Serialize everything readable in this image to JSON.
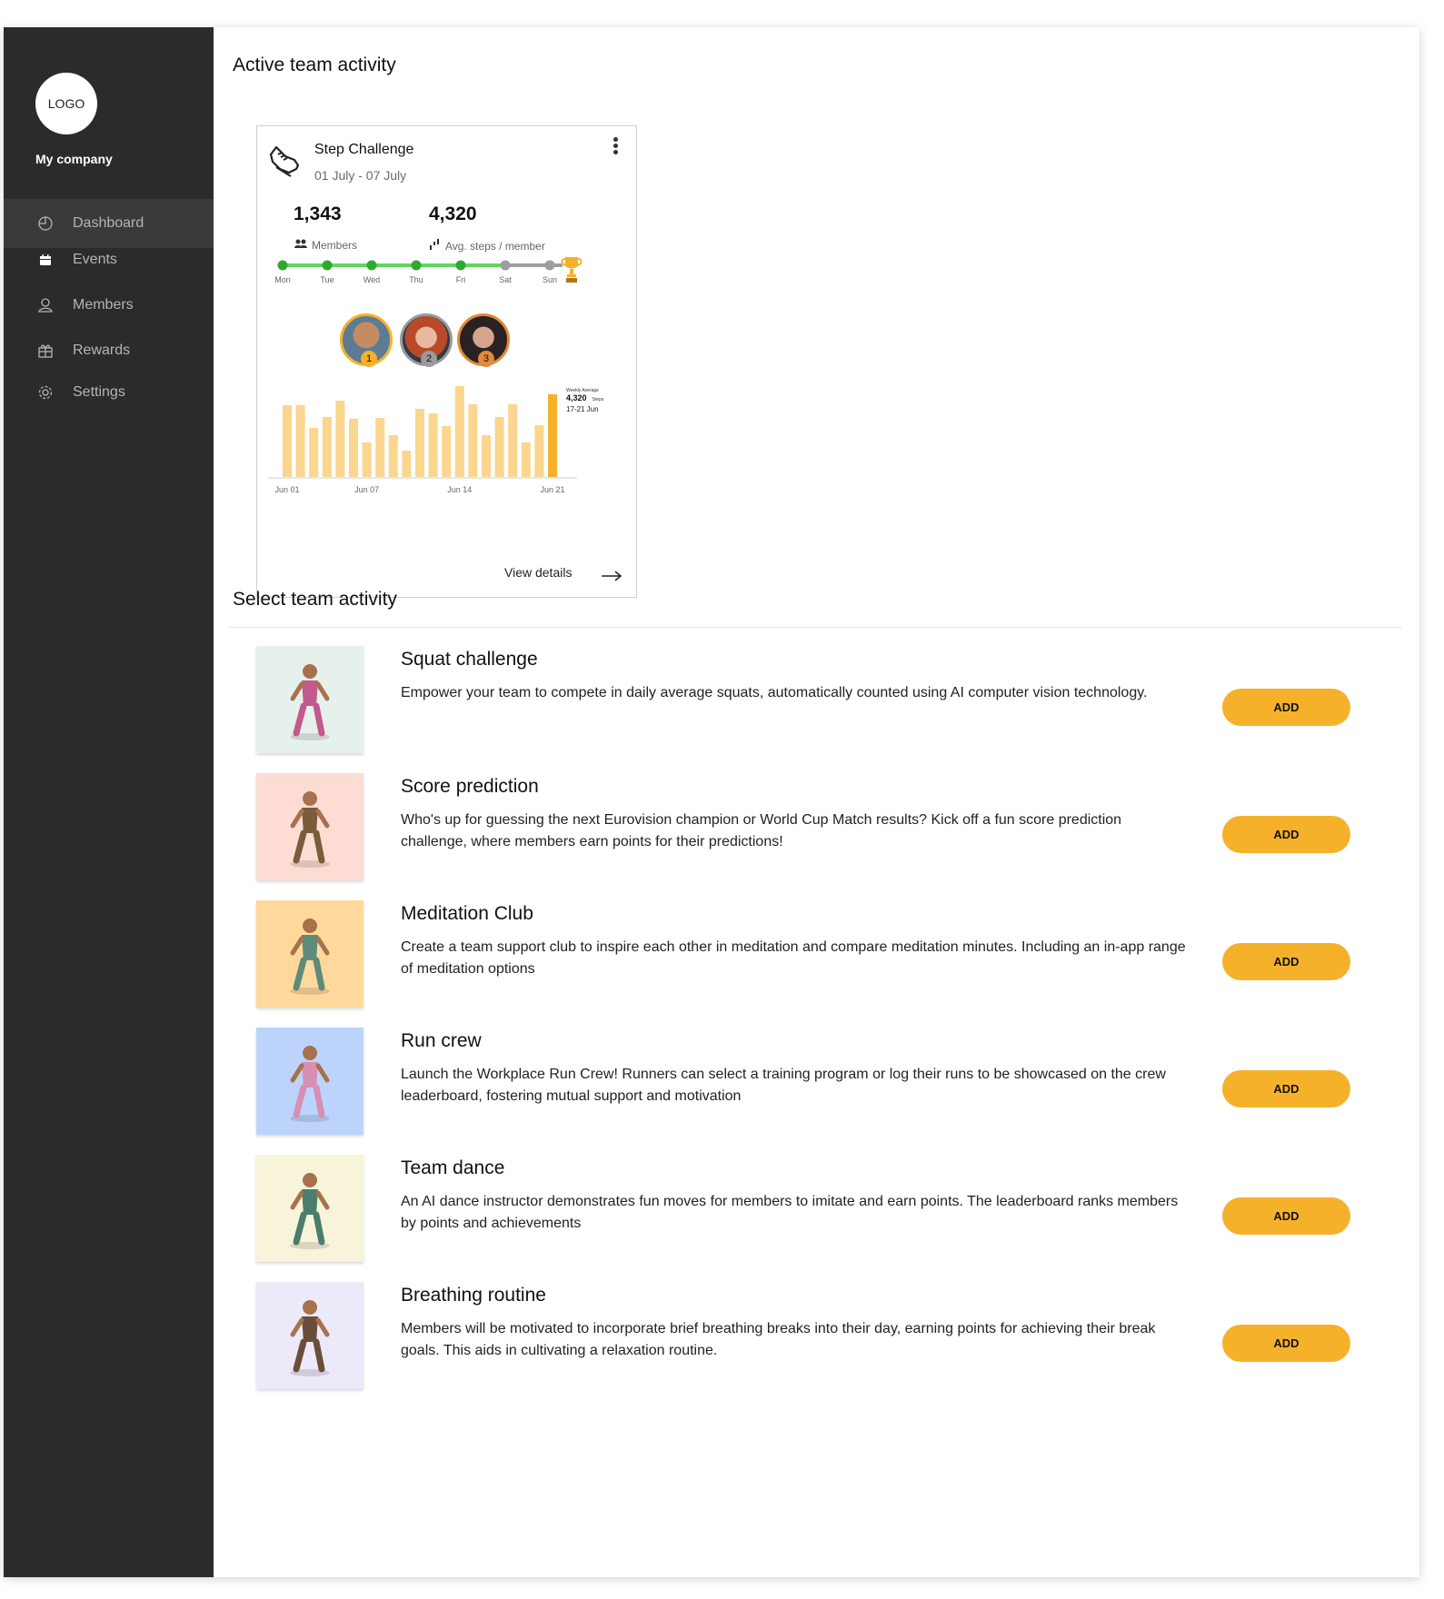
{
  "sidebar": {
    "logo": "LOGO",
    "company": "My company",
    "items": [
      {
        "label": "Dashboard",
        "icon": "dashboard-icon"
      },
      {
        "label": "Events",
        "icon": "calendar-icon"
      },
      {
        "label": "Members",
        "icon": "user-icon"
      },
      {
        "label": "Rewards",
        "icon": "gift-icon"
      },
      {
        "label": "Settings",
        "icon": "gear-icon"
      }
    ],
    "active": "Dashboard"
  },
  "active_section": {
    "heading": "Active team activity",
    "card": {
      "title": "Step Challenge",
      "date_range": "01 July - 07 July",
      "members_count": "1,343",
      "members_label": "Members",
      "avg_steps": "4,320",
      "avg_steps_label": "Avg. steps / member",
      "week": {
        "days": [
          "Mon",
          "Tue",
          "Wed",
          "Thu",
          "Fri",
          "Sat",
          "Sun"
        ],
        "completed": 5
      },
      "leaders": [
        "1",
        "2",
        "3"
      ],
      "view_details": "View details",
      "tooltip": {
        "label": "Weekly Average",
        "value": "4,320",
        "unit": "Steps",
        "range": "17-21 Jun"
      }
    }
  },
  "chart_data": {
    "type": "bar",
    "title": "",
    "xlabel": "",
    "ylabel": "",
    "tick_labels": [
      "Jun 01",
      "Jun 07",
      "Jun 14",
      "Jun 21"
    ],
    "x": [
      "Jun 01",
      "Jun 02",
      "Jun 03",
      "Jun 04",
      "Jun 05",
      "Jun 06",
      "Jun 07",
      "Jun 08",
      "Jun 09",
      "Jun 10",
      "Jun 11",
      "Jun 12",
      "Jun 13",
      "Jun 14",
      "Jun 15",
      "Jun 16",
      "Jun 17",
      "Jun 18",
      "Jun 19",
      "Jun 20",
      "Jun 21"
    ],
    "values": [
      79,
      79,
      54,
      66,
      84,
      64,
      38,
      65,
      46,
      29,
      75,
      70,
      56,
      100,
      80,
      46,
      66,
      80,
      38,
      57,
      91
    ],
    "highlight_index": 20,
    "ylim": [
      0,
      100
    ],
    "colors": {
      "bar": "#fbd68e",
      "highlight": "#f6b12b"
    }
  },
  "select_section": {
    "heading": "Select team activity",
    "activities": [
      {
        "title": "Squat challenge",
        "description": "Empower your team to compete in daily average squats, automatically counted using AI computer vision technology.",
        "button": "ADD",
        "bg": "#e6f1eb"
      },
      {
        "title": "Score prediction",
        "description": "Who's up for guessing the next Eurovision champion or World Cup Match results? Kick off a fun score prediction challenge, where members earn points for their predictions!",
        "button": "ADD",
        "bg": "#fcdcd3"
      },
      {
        "title": "Meditation Club",
        "description": "Create a team support club to inspire each other in meditation and compare meditation minutes. Including an in-app range of meditation options",
        "button": "ADD",
        "bg": "#fed99b"
      },
      {
        "title": "Run crew",
        "description": "Launch the Workplace Run Crew! Runners can select a training program or log their runs to be showcased on the crew leaderboard, fostering mutual support and motivation",
        "button": "ADD",
        "bg": "#bcd4fb"
      },
      {
        "title": "Team dance",
        "description": "An AI dance instructor demonstrates fun moves for members to imitate and earn points. The leaderboard ranks members by points and achievements",
        "button": "ADD",
        "bg": "#f8f4d9"
      },
      {
        "title": "Breathing routine",
        "description": "Members will be motivated to incorporate brief breathing breaks into their day, earning points for achieving their break goals. This aids in cultivating a relaxation routine.",
        "button": "ADD",
        "bg": "#ece9f9"
      }
    ]
  },
  "colors": {
    "accent": "#f6b12b",
    "sidebar": "#2b2b2b",
    "progress_done": "#2fa82f",
    "progress_done_line": "#5ed65e",
    "progress_todo": "#9e9e9e"
  }
}
